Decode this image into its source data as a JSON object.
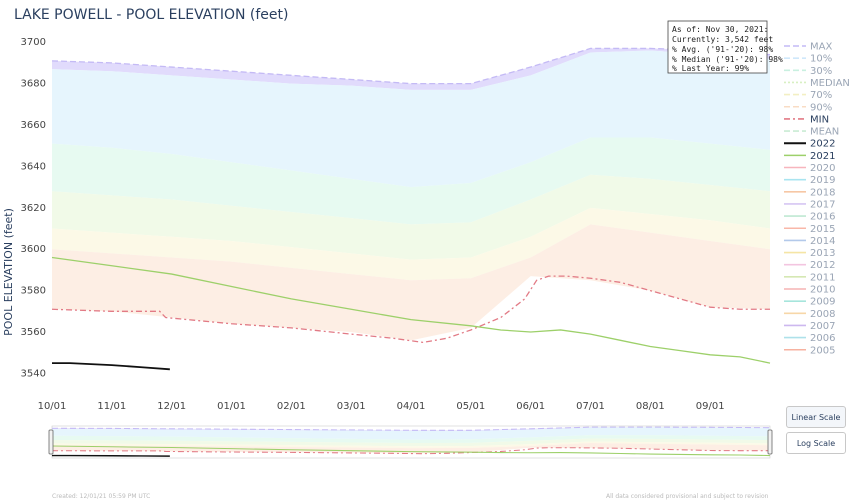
{
  "page": {
    "title": "LAKE POWELL - POOL ELEVATION (feet)",
    "footer_left": "Created: 12/01/21 05:59 PM UTC",
    "footer_right": "All data considered provisional and subject to revision"
  },
  "info_box": {
    "lines": [
      "As of: Nov 30, 2021:",
      "Currently: 3,542 feet",
      "% Avg. ('91-'20): 98%",
      "% Median ('91-'20): 98%",
      "% Last Year: 99%"
    ]
  },
  "buttons": {
    "linear": "Linear Scale",
    "log": "Log Scale"
  },
  "chart_data": {
    "type": "line",
    "title": "LAKE POWELL - POOL ELEVATION (feet)",
    "ylabel": "POOL ELEVATION (feet)",
    "xlabel": "",
    "x_ticks": [
      "10/01",
      "11/01",
      "12/01",
      "01/01",
      "02/01",
      "03/01",
      "04/01",
      "05/01",
      "06/01",
      "07/01",
      "08/01",
      "09/01"
    ],
    "y_ticks": [
      3540,
      3560,
      3580,
      3600,
      3620,
      3640,
      3660,
      3680,
      3700
    ],
    "ylim": [
      3532,
      3703
    ],
    "xlim": [
      0,
      12
    ],
    "bands": [
      {
        "name": "MAX-10%",
        "color": "#dcd5fb",
        "lower": [
          3687,
          3686,
          3684,
          3682,
          3680,
          3679,
          3677,
          3677,
          3684,
          3695,
          3696,
          3694,
          3692
        ],
        "upper": [
          3691,
          3690,
          3688,
          3686,
          3684,
          3682,
          3680,
          3680,
          3688,
          3697,
          3697,
          3696,
          3694
        ]
      },
      {
        "name": "10%-30%",
        "color": "#e2f3fd",
        "lower": [
          3651,
          3649,
          3646,
          3642,
          3638,
          3634,
          3630,
          3632,
          3642,
          3654,
          3654,
          3651,
          3648
        ],
        "upper": [
          3687,
          3686,
          3684,
          3682,
          3680,
          3679,
          3677,
          3677,
          3684,
          3695,
          3696,
          3694,
          3692
        ]
      },
      {
        "name": "30%-MEDIAN",
        "color": "#e3f9ef",
        "lower": [
          3628,
          3626,
          3624,
          3621,
          3618,
          3615,
          3612,
          3613,
          3624,
          3636,
          3634,
          3631,
          3628
        ],
        "upper": [
          3651,
          3649,
          3646,
          3642,
          3638,
          3634,
          3630,
          3632,
          3642,
          3654,
          3654,
          3651,
          3648
        ]
      },
      {
        "name": "MEDIAN-70%",
        "color": "#eef9e4",
        "lower": [
          3610,
          3608,
          3606,
          3604,
          3601,
          3598,
          3595,
          3596,
          3606,
          3620,
          3617,
          3614,
          3610
        ],
        "upper": [
          3628,
          3626,
          3624,
          3621,
          3618,
          3615,
          3612,
          3613,
          3624,
          3636,
          3634,
          3631,
          3628
        ]
      },
      {
        "name": "70%-90%",
        "color": "#fcf8e3",
        "lower": [
          3600,
          3598,
          3596,
          3594,
          3591,
          3588,
          3585,
          3586,
          3596,
          3612,
          3608,
          3604,
          3600
        ],
        "upper": [
          3610,
          3608,
          3606,
          3604,
          3601,
          3598,
          3595,
          3596,
          3606,
          3620,
          3617,
          3614,
          3610
        ]
      },
      {
        "name": "90%-MIN",
        "color": "#fdebdf",
        "lower": [
          3571,
          3570,
          3567,
          3564,
          3562,
          3560,
          3556,
          3562,
          3587,
          3585,
          3580,
          3572,
          3571
        ],
        "upper": [
          3600,
          3598,
          3596,
          3594,
          3591,
          3588,
          3585,
          3586,
          3596,
          3612,
          3608,
          3604,
          3600
        ]
      }
    ],
    "series": [
      {
        "name": "MAX",
        "color": "#c4baf5",
        "dash": "6,3",
        "points": [
          [
            0,
            3691
          ],
          [
            1,
            3690
          ],
          [
            2,
            3688
          ],
          [
            3,
            3686
          ],
          [
            4,
            3684
          ],
          [
            5,
            3682
          ],
          [
            6,
            3680
          ],
          [
            7,
            3680
          ],
          [
            8,
            3688
          ],
          [
            9,
            3697
          ],
          [
            10,
            3697
          ],
          [
            11,
            3696
          ],
          [
            12,
            3694
          ]
        ]
      },
      {
        "name": "MIN",
        "color": "#e27a85",
        "dash": "6,3,2,3",
        "points": [
          [
            0,
            3571
          ],
          [
            1,
            3570
          ],
          [
            1.8,
            3570
          ],
          [
            1.9,
            3567
          ],
          [
            3,
            3564
          ],
          [
            4,
            3562
          ],
          [
            5,
            3559
          ],
          [
            5.7,
            3557
          ],
          [
            6.2,
            3555
          ],
          [
            6.6,
            3557
          ],
          [
            7,
            3561
          ],
          [
            7.5,
            3567
          ],
          [
            7.9,
            3576
          ],
          [
            8.1,
            3585
          ],
          [
            8.3,
            3587
          ],
          [
            8.6,
            3587
          ],
          [
            9,
            3586
          ],
          [
            9.5,
            3584
          ],
          [
            10,
            3580
          ],
          [
            10.5,
            3576
          ],
          [
            11,
            3572
          ],
          [
            11.5,
            3571
          ],
          [
            12,
            3571
          ]
        ]
      },
      {
        "name": "2022",
        "color": "#111111",
        "dash": "",
        "width": 1.8,
        "points": [
          [
            0,
            3545
          ],
          [
            0.3,
            3545
          ],
          [
            1,
            3544
          ],
          [
            1.5,
            3543
          ],
          [
            1.97,
            3542
          ]
        ]
      },
      {
        "name": "2021",
        "color": "#9dd06a",
        "dash": "",
        "width": 1.3,
        "points": [
          [
            0,
            3596
          ],
          [
            1,
            3592
          ],
          [
            2,
            3588
          ],
          [
            3,
            3582
          ],
          [
            4,
            3576
          ],
          [
            5,
            3571
          ],
          [
            6,
            3566
          ],
          [
            7,
            3563
          ],
          [
            7.5,
            3561
          ],
          [
            8,
            3560
          ],
          [
            8.5,
            3561
          ],
          [
            9,
            3559
          ],
          [
            9.5,
            3556
          ],
          [
            10,
            3553
          ],
          [
            10.5,
            3551
          ],
          [
            11,
            3549
          ],
          [
            11.5,
            3548
          ],
          [
            12,
            3545
          ]
        ]
      }
    ],
    "legend": {
      "placement": "right",
      "entries": [
        {
          "label": "MAX",
          "color": "#c4baf5",
          "dash": "6,3"
        },
        {
          "label": "10%",
          "color": "#cfe8fb",
          "dash": "6,3"
        },
        {
          "label": "30%",
          "color": "#c9f0e0",
          "dash": "6,3"
        },
        {
          "label": "MEDIAN",
          "color": "#d8f0c2",
          "dash": "2,2"
        },
        {
          "label": "70%",
          "color": "#f3efc3",
          "dash": "6,3"
        },
        {
          "label": "90%",
          "color": "#f9dcc4",
          "dash": "6,3"
        },
        {
          "label": "MIN",
          "color": "#e27a85",
          "dash": "6,3,2,3"
        },
        {
          "label": "MEAN",
          "color": "#c9ecd4",
          "dash": "6,3"
        },
        {
          "label": "2022",
          "color": "#111111",
          "dash": "",
          "width": 2
        },
        {
          "label": "2021",
          "color": "#9dd06a",
          "dash": "",
          "width": 1.5
        },
        {
          "label": "2020",
          "color": "#f7b5bd",
          "dash": ""
        },
        {
          "label": "2019",
          "color": "#a9e4f0",
          "dash": ""
        },
        {
          "label": "2018",
          "color": "#f6c7a5",
          "dash": ""
        },
        {
          "label": "2017",
          "color": "#d6c6f3",
          "dash": ""
        },
        {
          "label": "2016",
          "color": "#bfe8d2",
          "dash": ""
        },
        {
          "label": "2015",
          "color": "#f9b7a8",
          "dash": ""
        },
        {
          "label": "2014",
          "color": "#b3c9ea",
          "dash": ""
        },
        {
          "label": "2013",
          "color": "#f5e5a5",
          "dash": ""
        },
        {
          "label": "2012",
          "color": "#f3c5e0",
          "dash": ""
        },
        {
          "label": "2011",
          "color": "#d5e8b3",
          "dash": ""
        },
        {
          "label": "2010",
          "color": "#f6b4b4",
          "dash": ""
        },
        {
          "label": "2009",
          "color": "#a6e5dc",
          "dash": ""
        },
        {
          "label": "2008",
          "color": "#f7d7a8",
          "dash": ""
        },
        {
          "label": "2007",
          "color": "#cdb8ef",
          "dash": ""
        },
        {
          "label": "2006",
          "color": "#aee1ea",
          "dash": ""
        },
        {
          "label": "2005",
          "color": "#f7b2a0",
          "dash": ""
        }
      ]
    }
  }
}
